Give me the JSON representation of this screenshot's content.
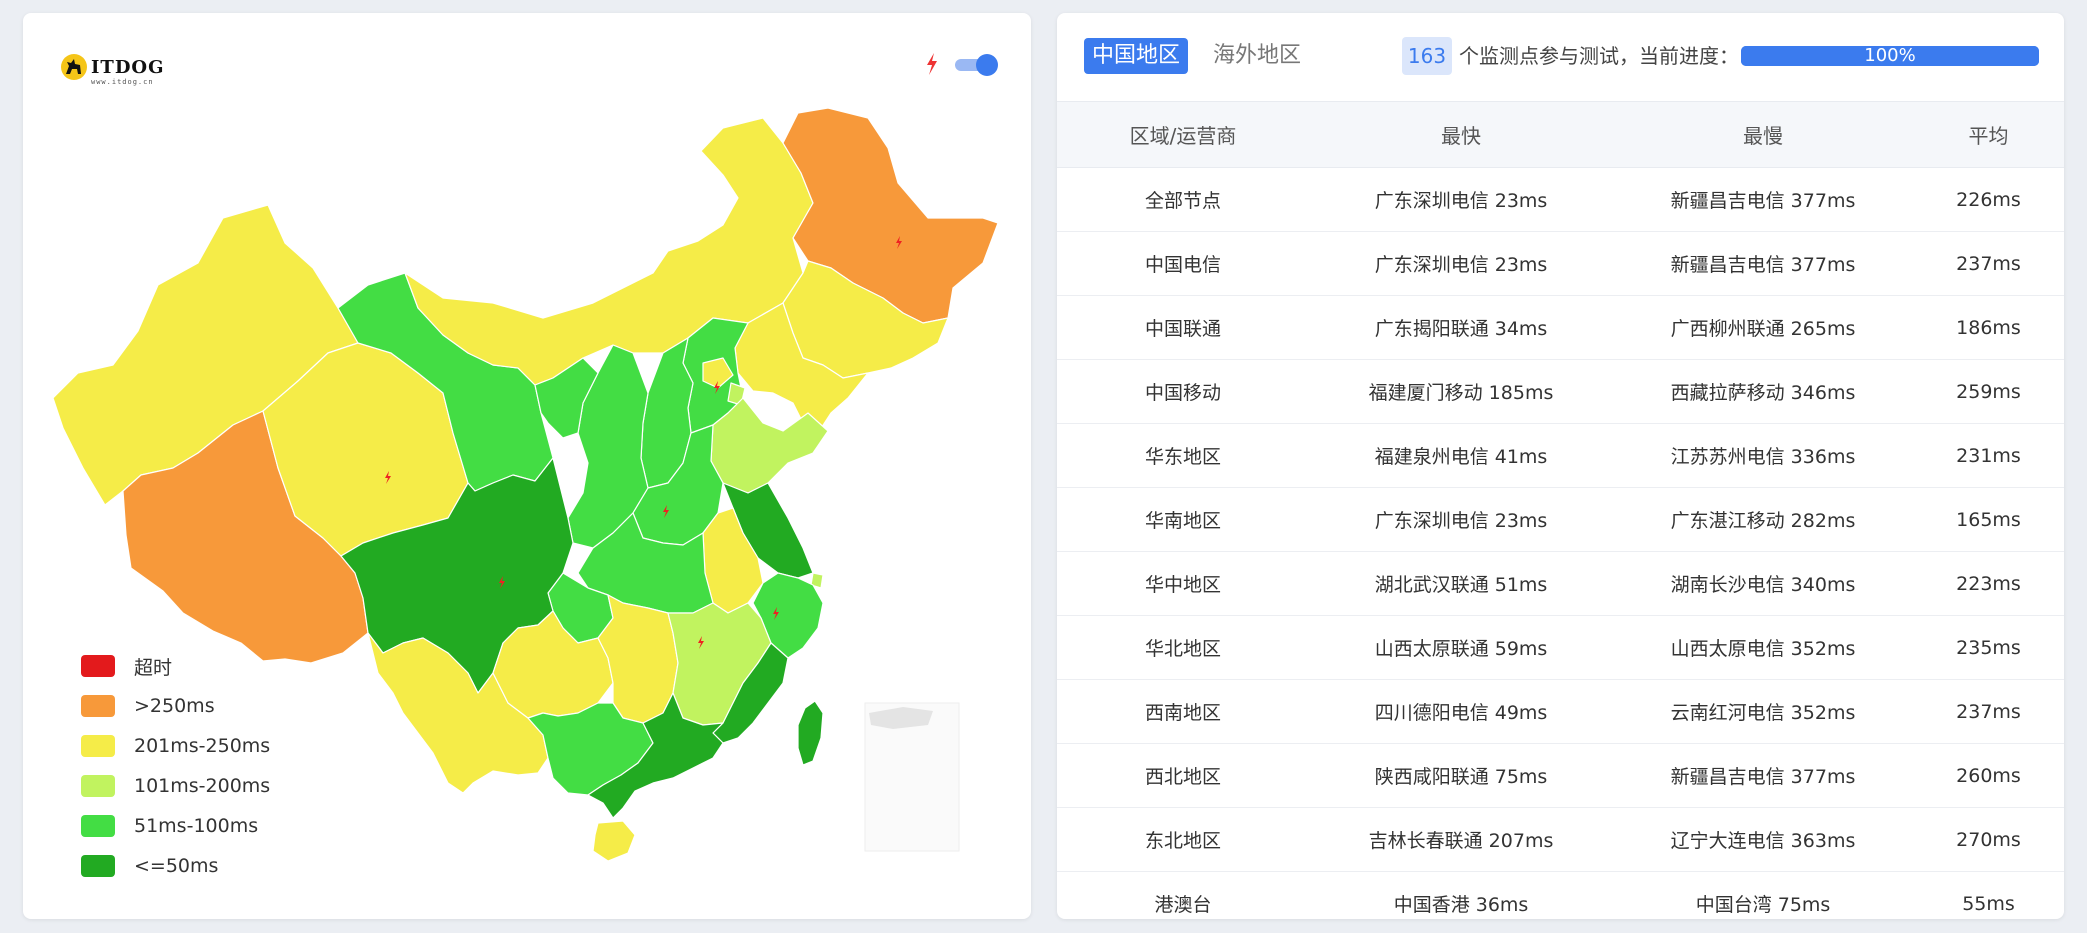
{
  "logo": {
    "text": "ITDOG",
    "sub": "www.itdog.cn"
  },
  "map": {
    "toggle_on": true,
    "legend": [
      {
        "label": "超时",
        "color": "#e31a1c"
      },
      {
        "label": ">250ms",
        "color": "#f7993a"
      },
      {
        "label": "201ms-250ms",
        "color": "#f5ec48"
      },
      {
        "label": "101ms-200ms",
        "color": "#c1f35f"
      },
      {
        "label": "51ms-100ms",
        "color": "#43dd44"
      },
      {
        "label": "<=50ms",
        "color": "#22aa22"
      }
    ]
  },
  "tabs": {
    "china": "中国地区",
    "overseas": "海外地区"
  },
  "monitor": {
    "count": "163",
    "text": "个监测点参与测试，当前进度：",
    "progress": 100,
    "progress_label": "100%"
  },
  "table": {
    "headers": [
      "区域/运营商",
      "最快",
      "最慢",
      "平均"
    ],
    "rows": [
      [
        "全部节点",
        "广东深圳电信 23ms",
        "新疆昌吉电信 377ms",
        "226ms"
      ],
      [
        "中国电信",
        "广东深圳电信 23ms",
        "新疆昌吉电信 377ms",
        "237ms"
      ],
      [
        "中国联通",
        "广东揭阳联通 34ms",
        "广西柳州联通 265ms",
        "186ms"
      ],
      [
        "中国移动",
        "福建厦门移动 185ms",
        "西藏拉萨移动 346ms",
        "259ms"
      ],
      [
        "华东地区",
        "福建泉州电信 41ms",
        "江苏苏州电信 336ms",
        "231ms"
      ],
      [
        "华南地区",
        "广东深圳电信 23ms",
        "广东湛江移动 282ms",
        "165ms"
      ],
      [
        "华中地区",
        "湖北武汉联通 51ms",
        "湖南长沙电信 340ms",
        "223ms"
      ],
      [
        "华北地区",
        "山西太原联通 59ms",
        "山西太原电信 352ms",
        "235ms"
      ],
      [
        "西南地区",
        "四川德阳电信 49ms",
        "云南红河电信 352ms",
        "237ms"
      ],
      [
        "西北地区",
        "陕西咸阳联通 75ms",
        "新疆昌吉电信 377ms",
        "260ms"
      ],
      [
        "东北地区",
        "吉林长春联通 207ms",
        "辽宁大连电信 363ms",
        "270ms"
      ],
      [
        "港澳台",
        "中国香港 36ms",
        "中国台湾 75ms",
        "55ms"
      ]
    ]
  }
}
